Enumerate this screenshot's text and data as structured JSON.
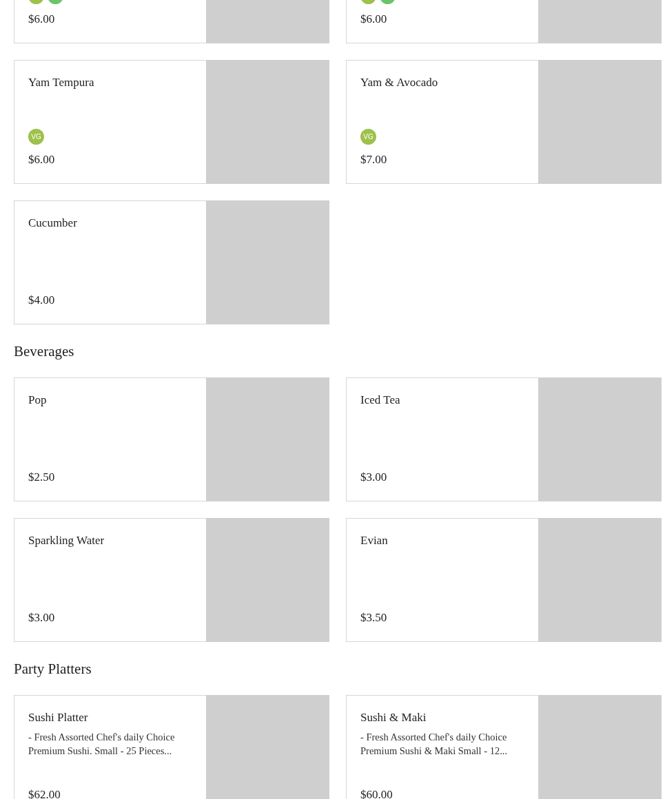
{
  "sections": [
    {
      "items": [
        {
          "price": "$6.00",
          "badges": [
            {
              "kind": "vegan"
            },
            {
              "kind": "vegetarian"
            }
          ]
        },
        {
          "price": "$6.00",
          "badges": [
            {
              "kind": "vegan"
            },
            {
              "kind": "vegetarian"
            }
          ]
        }
      ]
    },
    {
      "items": [
        {
          "name": "Yam Tempura",
          "price": "$6.00",
          "badges": [
            {
              "kind": "vegan",
              "label": "VG"
            }
          ]
        },
        {
          "name": "Yam & Avocado",
          "price": "$7.00",
          "badges": [
            {
              "kind": "vegan",
              "label": "VG"
            }
          ]
        },
        {
          "name": "Cucumber",
          "price": "$4.00"
        }
      ]
    },
    {
      "title": "Beverages",
      "items": [
        {
          "name": "Pop",
          "price": "$2.50"
        },
        {
          "name": "Iced Tea",
          "price": "$3.00"
        },
        {
          "name": "Sparkling Water",
          "price": "$3.00"
        },
        {
          "name": "Evian",
          "price": "$3.50"
        }
      ]
    },
    {
      "title": "Party Platters",
      "items": [
        {
          "name": "Sushi Platter",
          "description": "- Fresh Assorted Chef's daily Choice Premium Sushi. Small - 25 Pieces...",
          "price": "$62.00"
        },
        {
          "name": "Sushi & Maki",
          "description": "- Fresh Assorted Chef's daily Choice Premium Sushi & Maki Small - 12...",
          "price": "$60.00"
        }
      ]
    }
  ]
}
